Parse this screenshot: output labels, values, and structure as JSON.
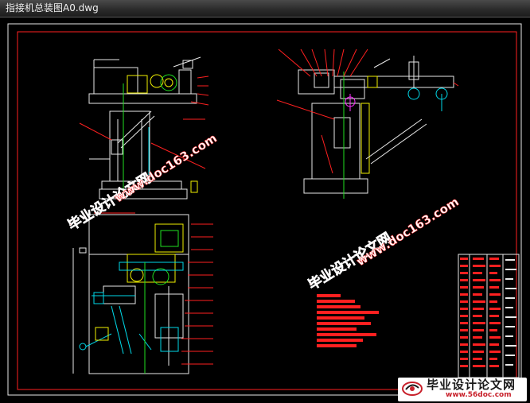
{
  "window": {
    "title": "指接机总装图A0.dwg"
  },
  "watermarks": {
    "site_name": "毕业设计论文网",
    "site_url": "www.doc163.com"
  },
  "footer_logo": {
    "name": "毕业设计论文网",
    "url": "www.56doc.com"
  },
  "colors": {
    "background": "#000000",
    "frame": "#ffffff",
    "border_red": "#ff2020",
    "line_white": "#e8e8e8",
    "line_yellow": "#f0f000",
    "line_cyan": "#00d8e8",
    "line_green": "#20e020",
    "line_magenta": "#ff30ff",
    "watermark_red": "#ff2a2a",
    "watermark_white": "#ffffff"
  },
  "icons": {
    "logo": "site-logo-icon"
  }
}
